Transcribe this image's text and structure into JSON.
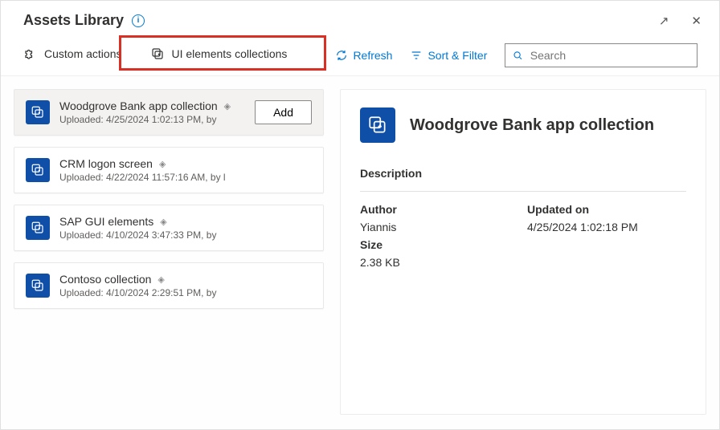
{
  "header": {
    "title": "Assets Library"
  },
  "tabs": {
    "custom_actions": "Custom actions",
    "ui_elements": "UI elements collections"
  },
  "toolbar": {
    "refresh": "Refresh",
    "sort_filter": "Sort & Filter",
    "search_placeholder": "Search",
    "add_label": "Add"
  },
  "collections": [
    {
      "name": "Woodgrove Bank app collection",
      "meta": "Uploaded: 4/25/2024 1:02:13 PM, by"
    },
    {
      "name": "CRM logon screen",
      "meta": "Uploaded: 4/22/2024 11:57:16 AM, by l"
    },
    {
      "name": "SAP GUI elements",
      "meta": "Uploaded: 4/10/2024 3:47:33 PM, by"
    },
    {
      "name": "Contoso collection",
      "meta": "Uploaded: 4/10/2024 2:29:51 PM, by"
    }
  ],
  "detail": {
    "title": "Woodgrove Bank app collection",
    "description_label": "Description",
    "author_label": "Author",
    "author_value": "Yiannis",
    "updated_label": "Updated on",
    "updated_value": "4/25/2024 1:02:18 PM",
    "size_label": "Size",
    "size_value": "2.38 KB"
  }
}
